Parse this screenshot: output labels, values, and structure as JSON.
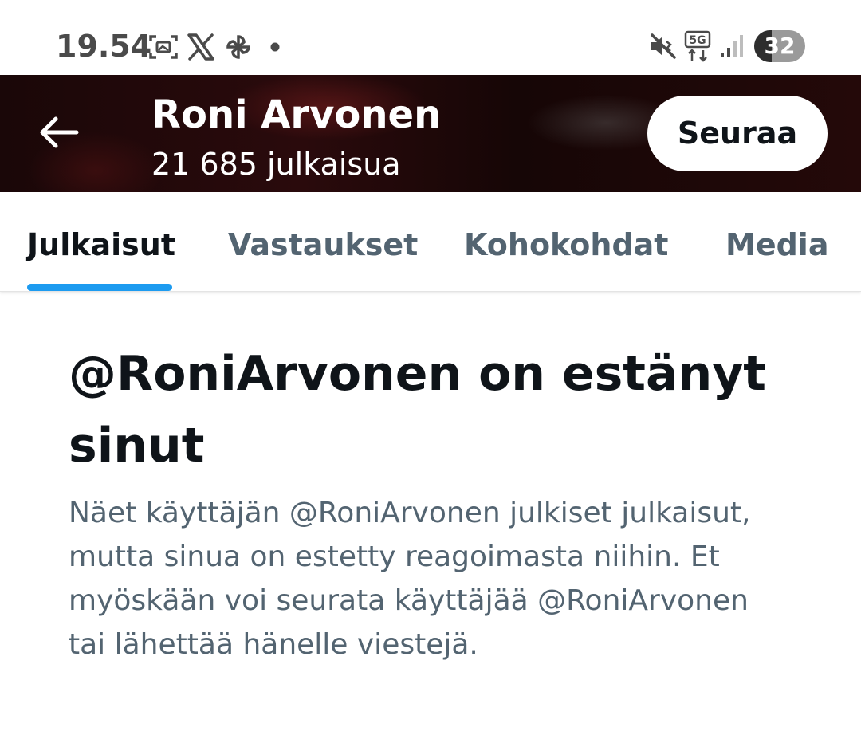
{
  "status_bar": {
    "time": "19.54",
    "icons": [
      "screenshot-icon",
      "x-logo-icon",
      "pinwheel-icon",
      "notification-dot-icon",
      "mute-icon",
      "5g-icon",
      "signal-icon"
    ],
    "network": "5G",
    "battery": "32"
  },
  "header": {
    "name": "Roni Arvonen",
    "post_count": "21 685 julkaisua",
    "follow_label": "Seuraa"
  },
  "tabs": [
    {
      "label": "Julkaisut",
      "active": true
    },
    {
      "label": "Vastaukset",
      "active": false
    },
    {
      "label": "Kohokohdat",
      "active": false
    },
    {
      "label": "Media",
      "active": false
    }
  ],
  "main": {
    "title": "@RoniArvonen on estänyt sinut",
    "description": "Näet käyttäjän @RoniArvonen julkiset julkaisut, mutta sinua on estetty reagoimasta niihin. Et myöskään voi seurata käyttäjää @RoniArvonen tai lähettää hänelle viestejä."
  },
  "colors": {
    "accent": "#1d9bf0",
    "primary_text": "#0f1419",
    "secondary_text": "#536471"
  }
}
